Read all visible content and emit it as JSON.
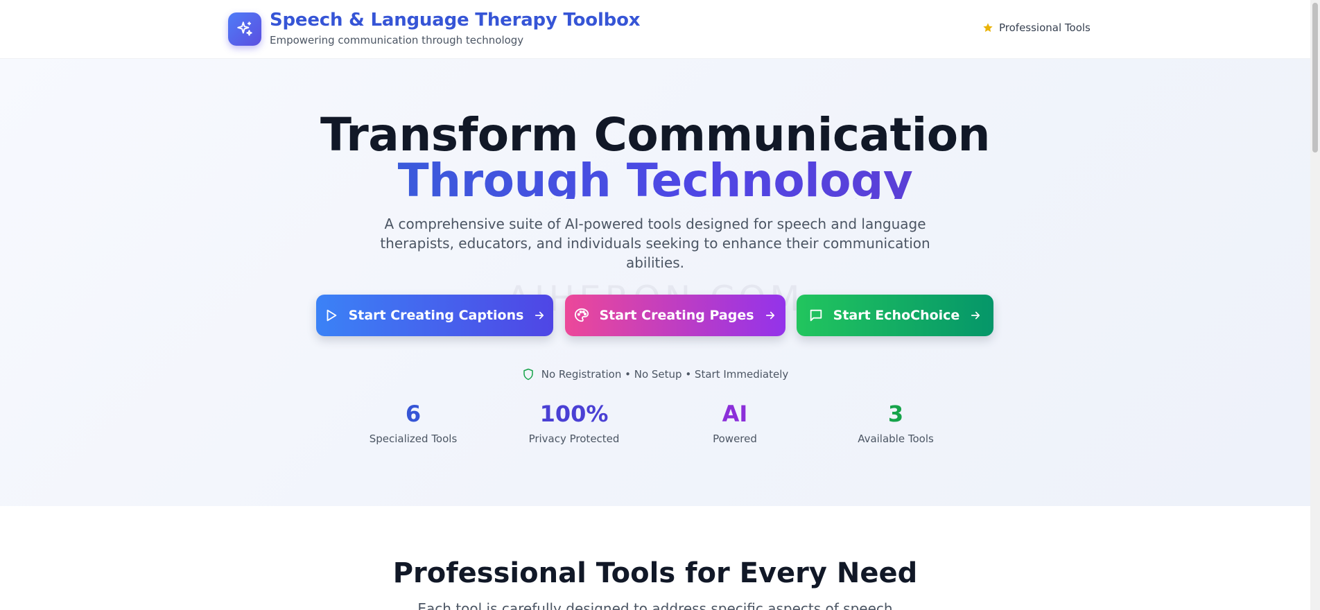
{
  "header": {
    "title": "Speech & Language Therapy Toolbox",
    "subtitle": "Empowering communication through technology",
    "logo_icon": "sparkles-icon",
    "badge_icon": "star-icon",
    "badge_label": "Professional Tools",
    "badge_icon_color": "#eab308"
  },
  "hero": {
    "headline_line1": "Transform Communication",
    "headline_line2": "Through Technology",
    "description": "A comprehensive suite of AI-powered tools designed for speech and language therapists, educators, and individuals seeking to enhance their communication abilities.",
    "watermark": "AIHERON.COM",
    "buttons": [
      {
        "label": "Start Creating Captions",
        "icon": "play-icon",
        "trailing_icon": "arrow-right-icon"
      },
      {
        "label": "Start Creating Pages",
        "icon": "palette-icon",
        "trailing_icon": "arrow-right-icon"
      },
      {
        "label": "Start EchoChoice",
        "icon": "message-square-icon",
        "trailing_icon": "arrow-right-icon"
      }
    ],
    "note_icon": "shield-icon",
    "note": "No Registration • No Setup • Start Immediately",
    "stats": [
      {
        "value": "6",
        "label": "Specialized Tools",
        "color": "#3655d6"
      },
      {
        "value": "100%",
        "label": "Privacy Protected",
        "color": "#4a40d4"
      },
      {
        "value": "AI",
        "label": "Powered",
        "color": "#8b2fd9"
      },
      {
        "value": "3",
        "label": "Available Tools",
        "color": "#16a34a"
      }
    ]
  },
  "section": {
    "title": "Professional Tools for Every Need",
    "description": "Each tool is carefully designed to address specific aspects of speech"
  },
  "colors": {
    "brand": "#3655d6",
    "heading": "#111827",
    "body_text": "#4b5563"
  }
}
